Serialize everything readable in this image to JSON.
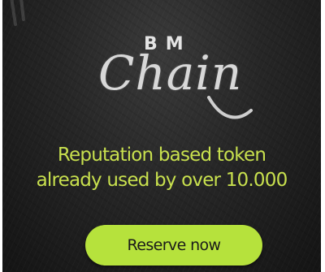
{
  "logo": {
    "top_text": "BM",
    "main_text": "Chain"
  },
  "tagline": {
    "line1": "Reputation based token",
    "line2": "already used by over 10.000"
  },
  "cta": {
    "label": "Reserve now"
  },
  "colors": {
    "background": "#1e1e1e",
    "accent_text": "#c8e04e",
    "button": "#b6e23c",
    "button_text": "#1a1a1a",
    "logo": "#d8d8d8"
  }
}
